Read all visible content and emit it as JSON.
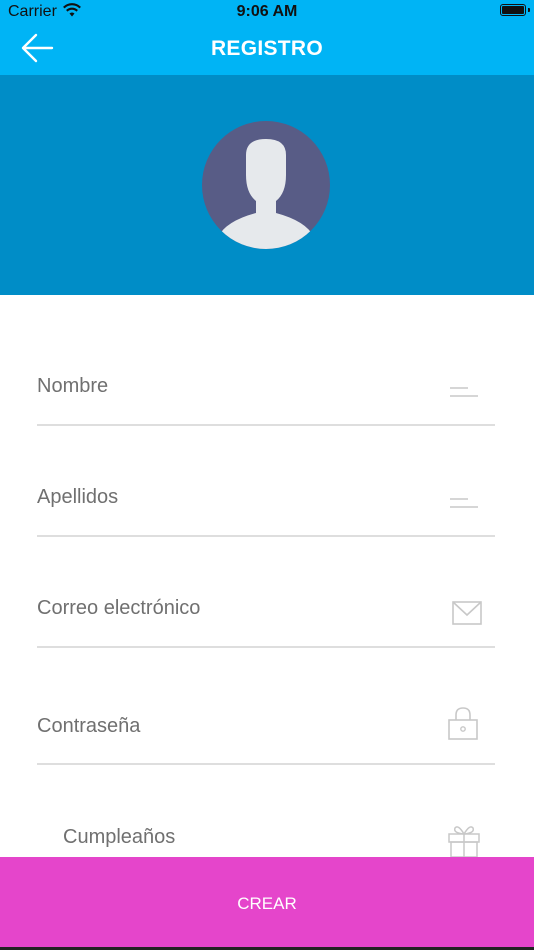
{
  "status_bar": {
    "carrier": "Carrier",
    "time": "9:06 AM"
  },
  "header": {
    "title": "REGISTRO",
    "back_icon": "arrow-left-icon"
  },
  "colors": {
    "nav_bar": "#00b4f5",
    "header_band": "#008dc7",
    "avatar_bg": "#585c86",
    "create_button": "#e545cb"
  },
  "form": {
    "fields": [
      {
        "label": "Nombre",
        "icon": "lines-icon"
      },
      {
        "label": "Apellidos",
        "icon": "lines-icon"
      },
      {
        "label": "Correo electrónico",
        "icon": "envelope-icon"
      },
      {
        "label": "Contraseña",
        "icon": "lock-icon"
      },
      {
        "label": "Cumpleaños",
        "icon": "gift-icon"
      }
    ]
  },
  "actions": {
    "create_label": "CREAR"
  }
}
